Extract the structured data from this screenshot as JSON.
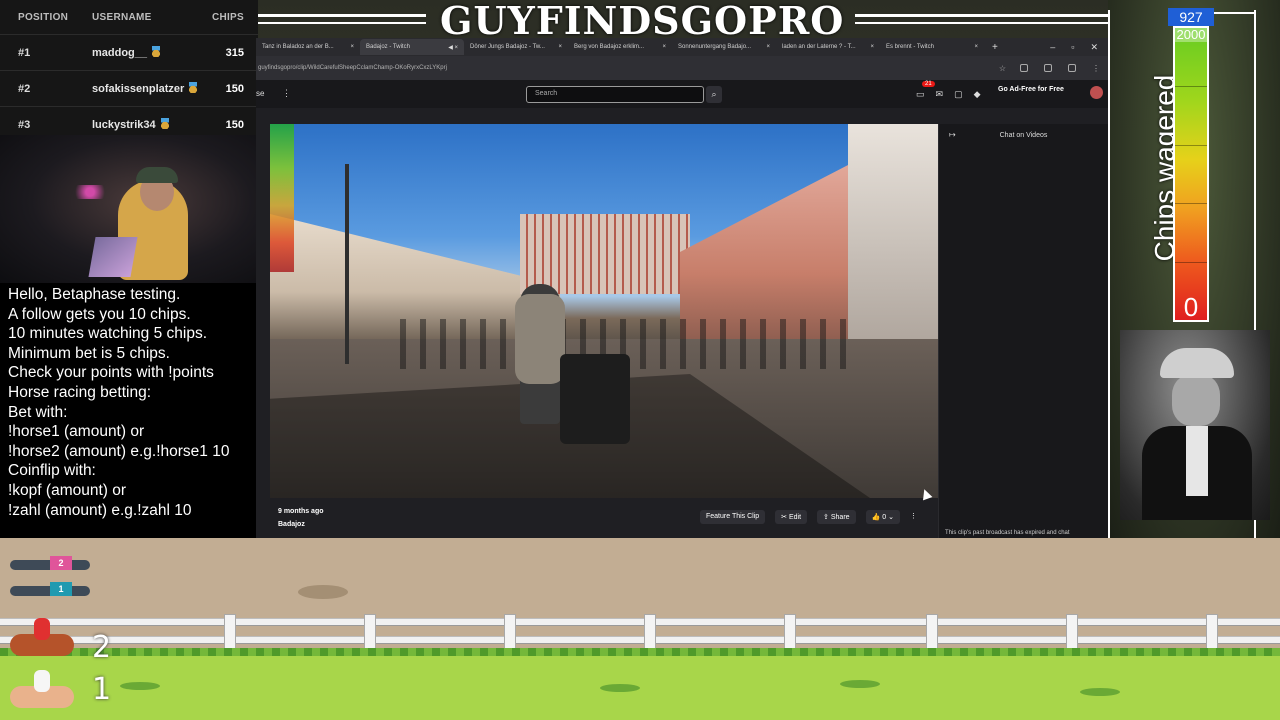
{
  "banner": {
    "title": "GUYFINDSGOPRO"
  },
  "leaderboard": {
    "headers": {
      "position": "POSITION",
      "username": "USERNAME",
      "chips": "CHIPS"
    },
    "rows": [
      {
        "position": "#1",
        "username": "maddog__",
        "chips": "315"
      },
      {
        "position": "#2",
        "username": "sofakissenplatzer",
        "chips": "150"
      },
      {
        "position": "#3",
        "username": "luckystrik34",
        "chips": "150"
      }
    ]
  },
  "info": {
    "lines": [
      "Hello, Betaphase testing.",
      "A follow gets you 10 chips.",
      "10 minutes watching 5 chips.",
      "Minimum bet is 5 chips.",
      "Check your points with !points",
      "Horse racing betting:",
      "Bet with:",
      "!horse1 (amount) or",
      "!horse2 (amount) e.g.!horse1 10",
      "Coinflip with:",
      "!kopf (amount) or",
      "!zahl (amount) e.g.!zahl 10"
    ]
  },
  "browser": {
    "tabs": [
      "Tanz in Baladoz an der B...",
      "Badajoz - Twitch",
      "Döner Jungs Badajoz - Tw...",
      "Berg von Badajoz erklim...",
      "Sonnenuntergang Badajo...",
      "laden an der Laterne ? - T...",
      "Es brennt - Twitch"
    ],
    "active_tab": 1,
    "url": "guyfindsgopro/clip/WildCarefulSheepCclamChamp-OKoRyrxCxzLYKprj",
    "search_placeholder": "Search",
    "notif_count": "21",
    "ad_free": "Go Ad-Free for Free",
    "left_label": "se",
    "video_time_ago": "9 months ago",
    "video_title": "Badajoz",
    "actions": {
      "feature": "Feature This Clip",
      "edit": "Edit",
      "share": "Share",
      "likes": "0"
    },
    "chat": {
      "header": "Chat on Videos",
      "expired": "This clip's past broadcast has expired and chat"
    }
  },
  "wager": {
    "label": "Chips wagered",
    "current": "927",
    "max": "2000",
    "min": "0",
    "level": 0.4635,
    "colors": {
      "top": "#66cc22",
      "bottom": "#e01f1f",
      "indicator": "#1f5fd6"
    }
  },
  "race": {
    "dogs": [
      {
        "number": "2",
        "color": "#e0559a"
      },
      {
        "number": "1",
        "color": "#1f9ab0"
      }
    ],
    "horses": [
      {
        "lane": "2",
        "color": "#b5532a"
      },
      {
        "lane": "1",
        "color": "#e9b28c"
      }
    ]
  }
}
